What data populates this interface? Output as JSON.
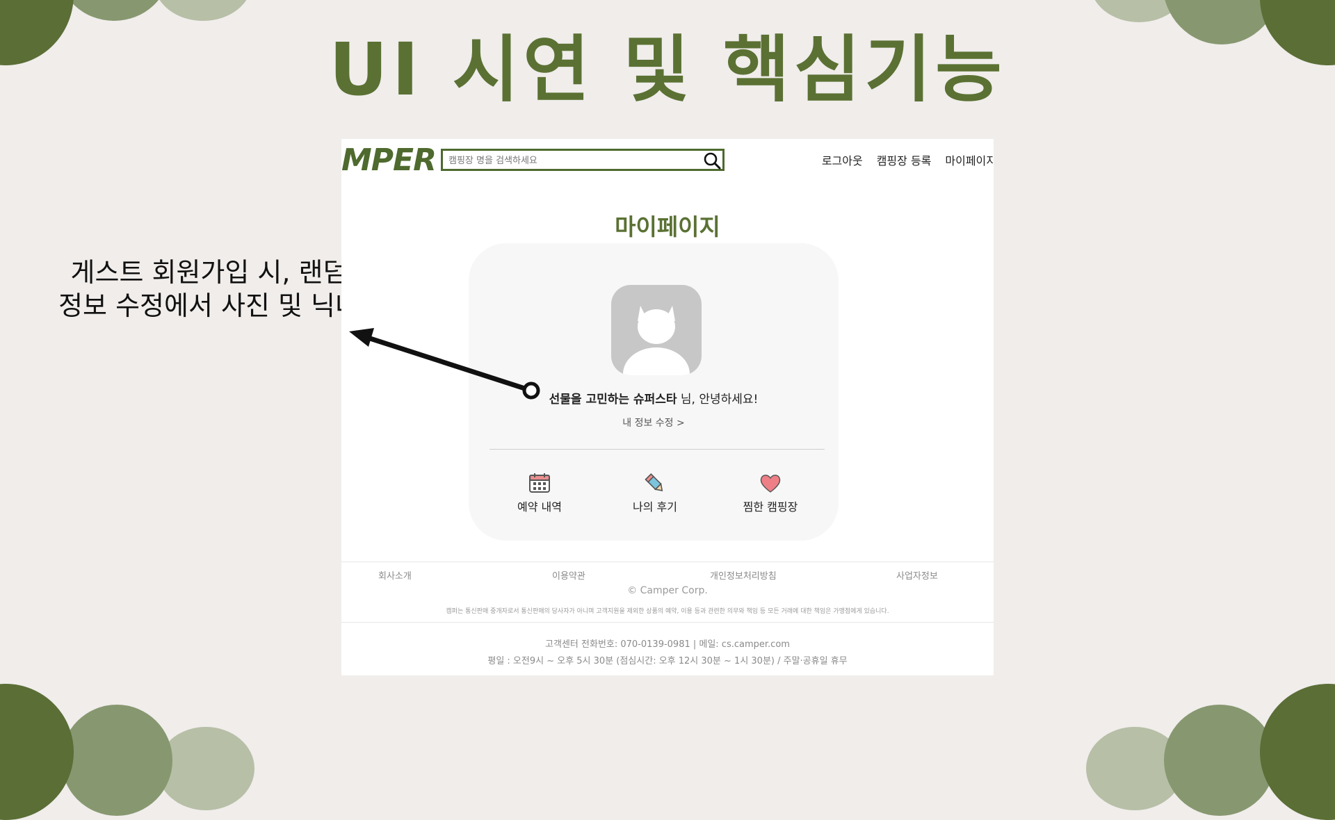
{
  "slide": {
    "title": "UI 시연 및 핵심기능",
    "annotation_line1": "게스트 회원가입 시, 랜덤 닉네임 생성",
    "annotation_line2": "정보 수정에서 사진 및 닉네임 변경 가능"
  },
  "app": {
    "logo": "MPER",
    "search": {
      "placeholder": "캠핑장 명을 검색하세요",
      "value": ""
    },
    "nav": [
      "로그아웃",
      "캠핑장 등록",
      "마이페이지"
    ],
    "page_title": "마이페이지",
    "profile": {
      "nickname": "선물을 고민하는 슈퍼스타",
      "greeting_suffix": " 님, 안녕하세요!",
      "edit_link": "내 정보 수정 >"
    },
    "menu": [
      {
        "label": "예약 내역",
        "icon": "calendar-icon"
      },
      {
        "label": "나의 후기",
        "icon": "pencil-icon"
      },
      {
        "label": "찜한 캠핑장",
        "icon": "heart-icon"
      }
    ],
    "footer": {
      "links": [
        "회사소개",
        "이용약관",
        "개인정보처리방침",
        "사업자정보"
      ],
      "copyright": "© Camper Corp.",
      "disclaimer": "캠퍼는 통신판매 중개자로서 통신판매의 당사자가 아니며 고객지원을 제외한 상품의 예약, 이용 등과 관련한 의무와 책임 등 모든 거래에 대한 책임은 가맹점에게 있습니다.",
      "contact": "고객센터 전화번호: 070-0139-0981 | 메일: cs.camper.com",
      "hours": "평일 : 오전9시 ~ 오후 5시 30분 (점심시간: 오후 12시 30분 ~ 1시 30분) / 주말·공휴일 휴무"
    }
  },
  "colors": {
    "background": "#f0edeb",
    "brand_green": "#5a7133",
    "circle_dark": "#5a6e36",
    "circle_mid": "#879870",
    "circle_light": "#b7bfa7"
  }
}
